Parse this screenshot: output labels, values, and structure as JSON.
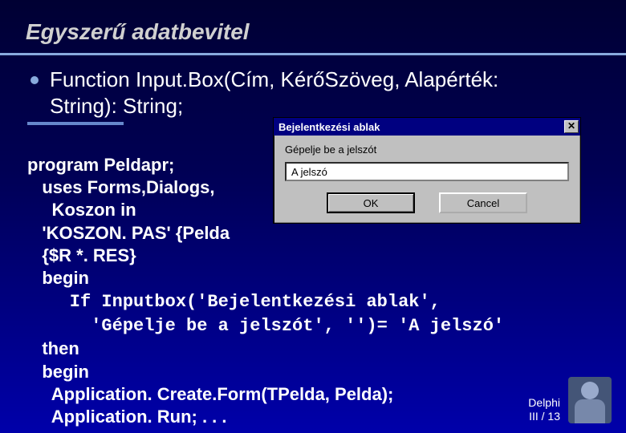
{
  "title": "Egyszerű adatbevitel",
  "bullet": {
    "func_line1": "Function Input.Box(Cím, KérőSzöveg, Alapérték:",
    "func_line2": "String): String;"
  },
  "code": {
    "l1": "program Peldapr;",
    "l2": "   uses Forms,Dialogs,",
    "l3": "     Koszon in",
    "l4": "   'KOSZON. PAS' {Pelda",
    "l5": "   {$R *. RES}",
    "l6": "   begin",
    "l7": "    If Inputbox('Bejelentkezési ablak',",
    "l8": "      'Gépelje be a jelszót', '')= 'A jelszó'",
    "l9": "   then",
    "l10": "   begin",
    "l11": "     Application. Create.Form(TPelda, Pelda);",
    "l12": "     Application. Run; . . ."
  },
  "dialog": {
    "title": "Bejelentkezési ablak",
    "prompt": "Gépelje be a jelszót",
    "value": "A jelszó",
    "ok": "OK",
    "cancel": "Cancel",
    "close_glyph": "✕"
  },
  "footer": {
    "line1": "Delphi",
    "line2": "III / 13"
  }
}
